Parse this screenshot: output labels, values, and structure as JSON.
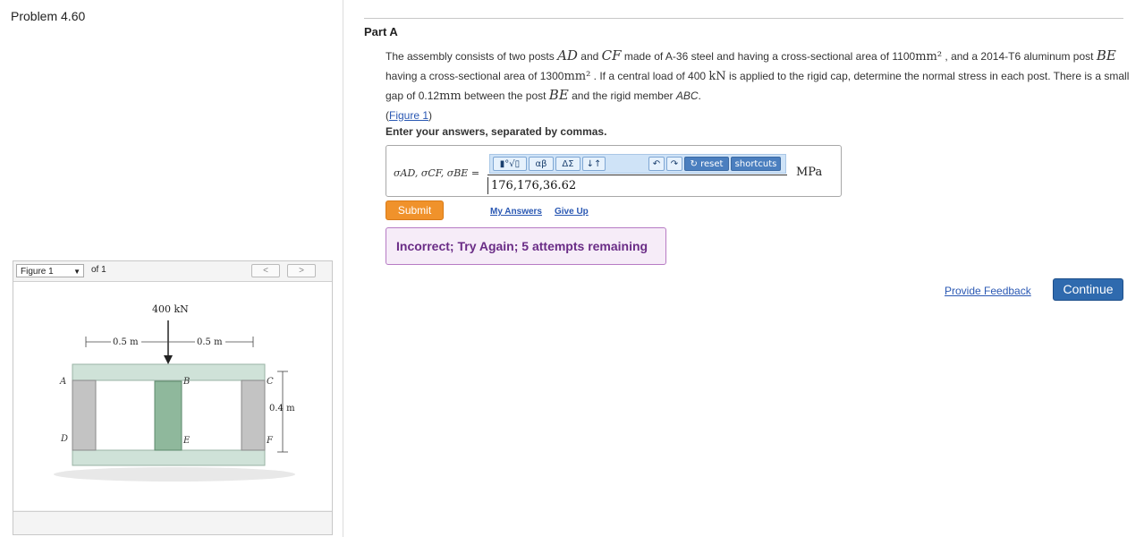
{
  "problem": {
    "title": "Problem 4.60"
  },
  "figure_panel": {
    "selected": "Figure 1",
    "of_label": "of 1",
    "prev_label": "<",
    "next_label": ">",
    "diagram": {
      "load": "400 kN",
      "dim_left": "0.5 m",
      "dim_right": "0.5 m",
      "dim_height": "0.4 m",
      "labels": {
        "A": "A",
        "B": "B",
        "C": "C",
        "D": "D",
        "E": "E",
        "F": "F"
      }
    }
  },
  "part": {
    "title": "Part A",
    "statement": {
      "s1": "The assembly consists of two posts ",
      "AD": "AD",
      "s2": " and ",
      "CF": "CF",
      "s3": " made of A-36 steel and having a cross-sectional area of 1100",
      "u1": "mm²",
      "s4": " , and a 2014-T6 aluminum post ",
      "BE": "BE",
      "s5": " having a cross-sectional area of 1300",
      "u2": "mm²",
      "s6": " . If a central load of 400 ",
      "u3": "kN",
      "s7": " is applied to the rigid cap, determine the normal stress in each post. There is a small gap of 0.12",
      "u4": "mm",
      "s8": " between the post ",
      "BE2": "BE",
      "s9": " and the rigid member ",
      "ABC": "ABC",
      "s10": "."
    },
    "figure_link": "Figure 1",
    "instruction": "Enter your answers, separated by commas."
  },
  "answer": {
    "label": "σAD, σCF, σBE =",
    "value": "176,176,36.62",
    "unit": "MPa",
    "toolbar": {
      "templates": "▮°√▯",
      "greek": "αβ",
      "symbols": "ΔΣ",
      "arrows": "↓↑",
      "undo": "↶",
      "redo": "↷",
      "reset": "↻ reset",
      "shortcuts": "shortcuts"
    }
  },
  "actions": {
    "submit": "Submit",
    "my_answers": "My Answers",
    "give_up": "Give Up"
  },
  "feedback": {
    "message": "Incorrect; Try Again; 5 attempts remaining"
  },
  "footer": {
    "provide_feedback": "Provide Feedback",
    "continue": "Continue"
  },
  "colors": {
    "submit": "#f0922b",
    "continue": "#2f6aae",
    "feedback_border": "#b77bc4",
    "feedback_text": "#6a2c86",
    "link": "#2a58b3",
    "post_steel": "#c3c3c3",
    "post_aluminum": "#8fb89c",
    "cap": "#cfe2d8"
  }
}
